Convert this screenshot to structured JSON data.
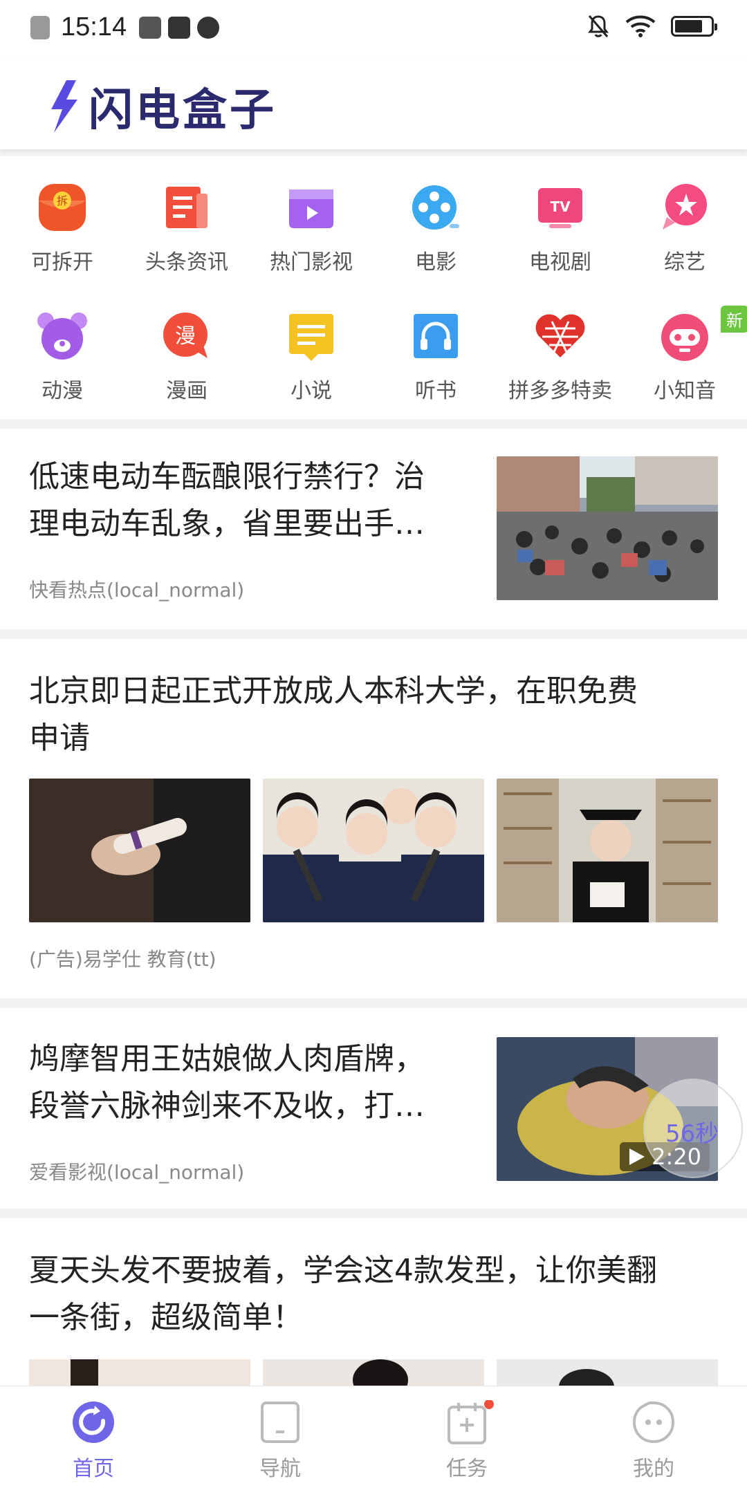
{
  "status_bar": {
    "time": "15:14"
  },
  "app": {
    "title": "闪电盒子"
  },
  "grid": {
    "row1": [
      {
        "label": "可拆开",
        "icon": "red-envelope-icon",
        "color": "#f0552a"
      },
      {
        "label": "头条资讯",
        "icon": "news-icon",
        "color": "#f2503c"
      },
      {
        "label": "热门影视",
        "icon": "video-clapper-icon",
        "color": "#a561f0"
      },
      {
        "label": "电影",
        "icon": "film-reel-icon",
        "color": "#3aa9f0"
      },
      {
        "label": "电视剧",
        "icon": "tv-icon",
        "color": "#f0477a"
      },
      {
        "label": "综艺",
        "icon": "variety-star-icon",
        "color": "#f54b7e"
      }
    ],
    "row2": [
      {
        "label": "动漫",
        "icon": "bear-icon",
        "color": "#a35ce6"
      },
      {
        "label": "漫画",
        "icon": "comic-icon",
        "color": "#f04e3a",
        "glyph": "漫"
      },
      {
        "label": "小说",
        "icon": "novel-icon",
        "color": "#f5c321"
      },
      {
        "label": "听书",
        "icon": "headphones-icon",
        "color": "#3a9df0"
      },
      {
        "label": "拼多多特卖",
        "icon": "pinduoduo-heart-icon",
        "color": "#e0322b"
      },
      {
        "label": "小知音",
        "icon": "robot-icon",
        "color": "#f04e78",
        "badge": "新"
      }
    ]
  },
  "feed": [
    {
      "title_line1": "低速电动车酝酿限行禁行？治",
      "title_line2": "理电动车乱象，省里要出手…",
      "source": "快看热点(local_normal)"
    },
    {
      "title_line1": "北京即日起正式开放成人本科大学，在职免费",
      "title_line2": "申请",
      "source": "(广告)易学仕 教育(tt)"
    },
    {
      "title_line1": "鸠摩智用王姑娘做人肉盾牌，",
      "title_line2": "段誉六脉神剑来不及收，打…",
      "source": "爱看影视(local_normal)",
      "duration": "2:20",
      "timer": "56秒"
    },
    {
      "title_line1": "夏天头发不要披着，学会这4款发型，让你美翻",
      "title_line2": "一条街，超级简单！"
    }
  ],
  "nav": [
    {
      "label": "首页",
      "icon": "home-icon"
    },
    {
      "label": "导航",
      "icon": "navigation-icon"
    },
    {
      "label": "任务",
      "icon": "task-icon"
    },
    {
      "label": "我的",
      "icon": "profile-icon"
    }
  ],
  "colors": {
    "accent": "#6e66e6",
    "brand": "#2b2a6e"
  }
}
